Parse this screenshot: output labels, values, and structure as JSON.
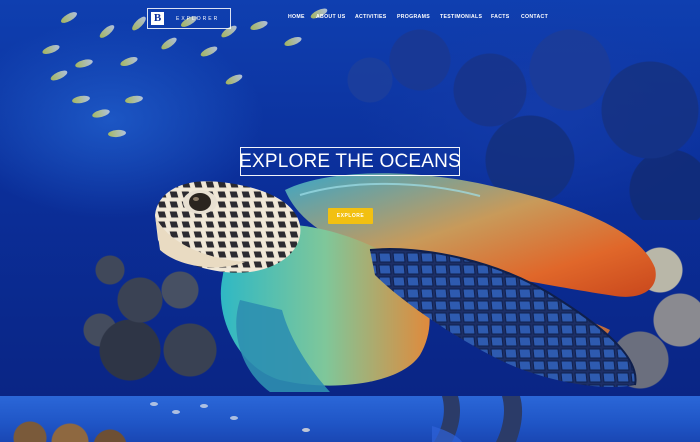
{
  "logo": {
    "mark": "B",
    "text": "EXPLORER"
  },
  "nav": {
    "items": [
      "HOME",
      "ABOUT US",
      "ACTIVITIES",
      "PROGRAMS",
      "TESTIMONIALS",
      "FACTS",
      "CONTACT"
    ]
  },
  "hero": {
    "headline": "EXPLORE THE OCEANS",
    "button_label": "EXPLORE"
  },
  "colors": {
    "accent": "#f2c011",
    "ocean": "#0b2f9a"
  }
}
